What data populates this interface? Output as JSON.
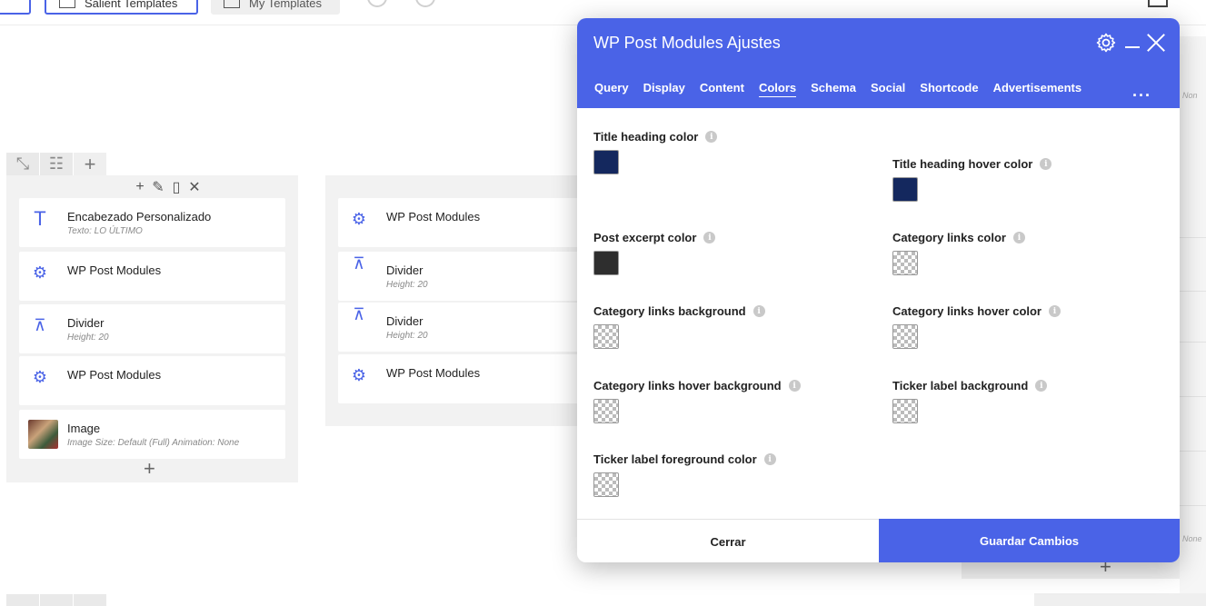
{
  "toolbar": {
    "add_label": "",
    "salient_label": "Salient Templates",
    "my_label": "My Templates"
  },
  "columns": [
    {
      "modules": [
        {
          "icon": "text-icon",
          "title": "Encabezado Personalizado",
          "sub": "Texto: LO ÚLTIMO"
        },
        {
          "icon": "gear-icon",
          "title": "WP Post Modules",
          "sub": ""
        },
        {
          "icon": "divider-icon",
          "title": "Divider",
          "sub": "Height: 20"
        },
        {
          "icon": "gear-icon",
          "title": "WP Post Modules",
          "sub": ""
        },
        {
          "icon": "image-thumbnail",
          "title": "Image",
          "sub": "Image Size: Default (Full)  Animation: None"
        }
      ]
    },
    {
      "modules": [
        {
          "icon": "gear-icon",
          "title": "WP Post Modules",
          "sub": ""
        },
        {
          "icon": "divider-icon",
          "title": "Divider",
          "sub": "Height: 20"
        },
        {
          "icon": "divider-icon",
          "title": "Divider",
          "sub": "Height: 20"
        },
        {
          "icon": "gear-icon",
          "title": "WP Post Modules",
          "sub": ""
        }
      ]
    }
  ],
  "ghost_text": {
    "a": "Non",
    "b": "None"
  },
  "modal": {
    "title": "WP Post Modules Ajustes",
    "tabs": [
      {
        "label": "Query",
        "active": false
      },
      {
        "label": "Display",
        "active": false
      },
      {
        "label": "Content",
        "active": false
      },
      {
        "label": "Colors",
        "active": true
      },
      {
        "label": "Schema",
        "active": false
      },
      {
        "label": "Social",
        "active": false
      },
      {
        "label": "Shortcode",
        "active": false
      },
      {
        "label": "Advertisements",
        "active": false
      }
    ],
    "more": "...",
    "fields": {
      "title_heading": {
        "label": "Title heading color",
        "color": "#14285e"
      },
      "title_heading_hover": {
        "label": "Title heading hover color",
        "color": "#14285e"
      },
      "post_excerpt": {
        "label": "Post excerpt color",
        "color": "#2e2e2e"
      },
      "category_links": {
        "label": "Category links color",
        "color": "transparent"
      },
      "category_links_bg": {
        "label": "Category links background",
        "color": "transparent"
      },
      "category_links_hover": {
        "label": "Category links hover color",
        "color": "transparent"
      },
      "category_links_hover_bg": {
        "label": "Category links hover background",
        "color": "transparent"
      },
      "ticker_label_bg": {
        "label": "Ticker label background",
        "color": "transparent"
      },
      "ticker_label_fg": {
        "label": "Ticker label foreground color",
        "color": "transparent"
      }
    },
    "close_label": "Cerrar",
    "save_label": "Guardar Cambios"
  },
  "colors": {
    "accent": "#4a63e7"
  }
}
